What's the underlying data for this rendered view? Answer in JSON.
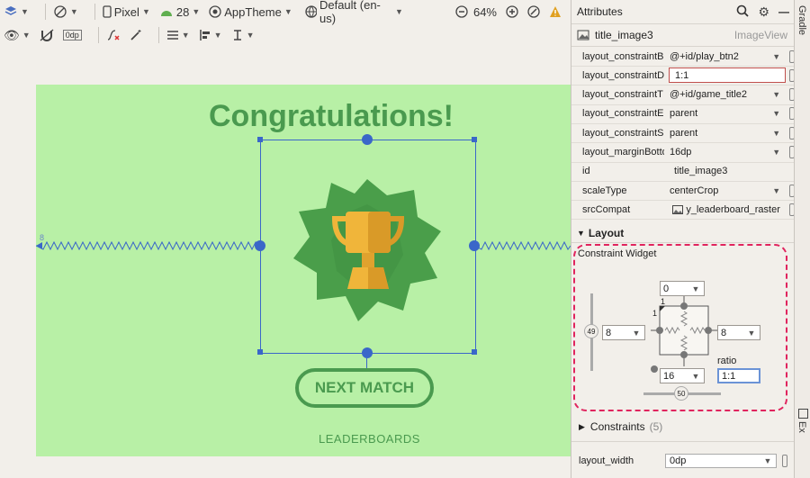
{
  "toolbar": {
    "device": "Pixel",
    "api": "28",
    "theme": "AppTheme",
    "locale": "Default (en-us)",
    "zoom": "64%",
    "dp_label": "0dp"
  },
  "canvas": {
    "title": "Congratulations!",
    "next_match": "NEXT MATCH",
    "leaderboards": "LEADERBOARDS",
    "margin_marker": "8"
  },
  "attributes": {
    "header": "Attributes",
    "component_id": "title_image3",
    "component_type": "ImageView",
    "rows": [
      {
        "name": "layout_constraintB",
        "value": "@+id/play_btn2",
        "dropdown": true
      },
      {
        "name": "layout_constraintD",
        "value": "1:1",
        "dropdown": false
      },
      {
        "name": "layout_constraintT",
        "value": "@+id/game_title2",
        "dropdown": true
      },
      {
        "name": "layout_constraintE",
        "value": "parent",
        "dropdown": true
      },
      {
        "name": "layout_constraintS",
        "value": "parent",
        "dropdown": true
      },
      {
        "name": "layout_marginBotto",
        "value": "16dp",
        "dropdown": true
      },
      {
        "name": "id",
        "value": "title_image3",
        "dropdown": false
      },
      {
        "name": "scaleType",
        "value": "centerCrop",
        "dropdown": true
      },
      {
        "name": "srcCompat",
        "value": "y_leaderboard_raster",
        "dropdown": false
      }
    ],
    "layout_section": "Layout",
    "constraint_widget_title": "Constraint Widget",
    "widget": {
      "top": "0",
      "left": "8",
      "right": "8",
      "bottom": "16",
      "ratio_label": "ratio",
      "ratio_value": "1:1",
      "vertical_bias": "49",
      "horizontal_bias": "50",
      "corner_label": "1"
    },
    "constraints_label": "Constraints",
    "constraints_count": "(5)",
    "layout_width_label": "layout_width",
    "layout_width_value": "0dp"
  },
  "side_tabs": {
    "gradle": "Gradle",
    "device_file": "Device File Ex"
  },
  "colors": {
    "screen_bg": "#b8f0a6",
    "accent_green": "#4a9a4f",
    "selection_blue": "#3a67c9",
    "highlight_red": "#e0245e"
  }
}
